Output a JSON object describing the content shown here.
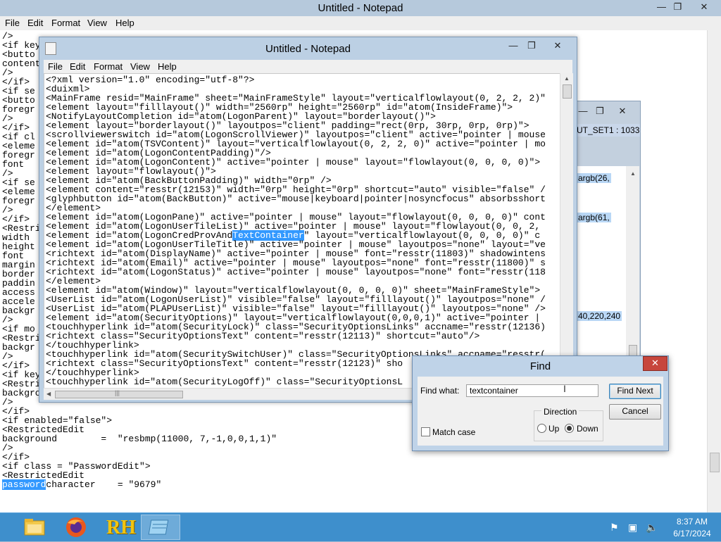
{
  "back_window": {
    "title": "Untitled - Notepad",
    "menu": [
      "File",
      "Edit",
      "Format",
      "View",
      "Help"
    ],
    "lines": [
      "/>",
      "<if key",
      "<butto",
      "content",
      "/>",
      "</if>",
      "<if se",
      "<butto",
      "foregr",
      "/>",
      "</if>",
      "<if cl",
      "<eleme",
      "foregr",
      "font",
      "/>",
      "<if se",
      "<eleme",
      "foregr",
      "/>",
      "</if>",
      "<Restri",
      "width",
      "height",
      "font",
      "margin",
      "border",
      "paddin",
      "access",
      "accele",
      "backgr",
      "/>",
      "<if mo",
      "<Restri",
      "backgr",
      "/>",
      "</if>",
      "<if key",
      "<Restri",
      "background        =  \"resbmp(11001, 7,-1,0,0,1,1)\"",
      "/>",
      "</if>",
      "<if enabled=\"false\">",
      "<RestrictedEdit",
      "background        =  \"resbmp(11000, 7,-1,0,0,1,1)\"",
      "/>",
      "</if>",
      "<if class = \"PasswordEdit\">",
      "<RestrictedEdit"
    ],
    "last_line_highlight": "password",
    "last_line_rest": "character    = \"9679\""
  },
  "mid_window": {
    "label": "UT_SET1 : 1033",
    "lines": [
      {
        "text": "argb(26,",
        "top": 0
      },
      {
        "text": "argb(61,",
        "top": 0
      },
      {
        "text": "40,220,240",
        "top": 0
      }
    ]
  },
  "front_window": {
    "title": "Untitled - Notepad",
    "menu": [
      "File",
      "Edit",
      "Format",
      "View",
      "Help"
    ],
    "lines": [
      "<?xml version=\"1.0\" encoding=\"utf-8\"?>",
      "<duixml>",
      "<MainFrame resid=\"MainFrame\" sheet=\"MainFrameStyle\" layout=\"verticalflowlayout(0, 2, 2, 2)\"",
      "<element layout=\"filllayout()\" width=\"2560rp\" height=\"2560rp\" id=\"atom(InsideFrame)\">",
      "<NotifyLayoutCompletion id=\"atom(LogonParent)\" layout=\"borderlayout()\">",
      "<element layout=\"borderlayout()\" layoutpos=\"client\" padding=\"rect(0rp, 30rp, 0rp, 0rp)\">",
      "<scrollviewerswitch id=\"atom(LogonScrollViewer)\" layoutpos=\"client\" active=\"pointer | mouse",
      "<element id=\"atom(TSVContent)\" layout=\"verticalflowlayout(0, 2, 2, 0)\" active=\"pointer | mo",
      "<element id=\"atom(LogonContentPadding)\"/>",
      "<element id=\"atom(LogonContent)\" active=\"pointer | mouse\" layout=\"flowlayout(0, 0, 0, 0)\">",
      "<element layout=\"flowlayout()\">",
      "<element id=\"atom(BackButtonPadding)\" width=\"0rp\" />",
      "<element content=\"resstr(12153)\" width=\"0rp\" height=\"0rp\" shortcut=\"auto\" visible=\"false\" /",
      "<glyphbutton id=\"atom(BackButton)\" active=\"mouse|keyboard|pointer|nosyncfocus\" absorbsshort",
      "</element>",
      "<element id=\"atom(LogonPane)\" active=\"pointer | mouse\" layout=\"flowlayout(0, 0, 0, 0)\" cont",
      "<element id=\"atom(LogonUserTileList)\" active=\"pointer | mouse\" layout=\"flowlayout(0, 0, 2,",
      "<element id=\"atom(LogonCredProvAnd",
      "<element id=\"atom(LogonUserTileTitle)\" active=\"pointer | mouse\" layoutpos=\"none\" layout=\"ve",
      "<richtext id=\"atom(DisplayName)\" active=\"pointer | mouse\" font=\"resstr(11803)\" shadowintens",
      "<richtext id=\"atom(Email)\" active=\"pointer | mouse\" layoutpos=\"none\" font=\"resstr(11800)\" s",
      "<richtext id=\"atom(LogonStatus)\" active=\"pointer | mouse\" layoutpos=\"none\" font=\"resstr(118",
      "</element>",
      "<element id=\"atom(Window)\" layout=\"verticalflowlayout(0, 0, 0, 0)\" sheet=\"MainFrameStyle\">",
      "<UserList id=\"atom(LogonUserList)\" visible=\"false\" layout=\"filllayout()\" layoutpos=\"none\" /",
      "<UserList id=\"atom(PLAPUserList)\" visible=\"false\" layout=\"filllayout()\" layoutpos=\"none\" />",
      "<element id=\"atom(SecurityOptions)\" layout=\"verticalflowlayout(0,0,0,1)\" active=\"pointer |",
      "<touchhyperlink id=\"atom(SecurityLock)\" class=\"SecurityOptionsLinks\" accname=\"resstr(12136)",
      "<richtext class=\"SecurityOptionsText\" content=\"resstr(12113)\" shortcut=\"auto\"/>",
      "</touchhyperlink>",
      "<touchhyperlink id=\"atom(SecuritySwitchUser)\" class=\"SecurityOptionsLinks\" accname=\"resstr(",
      "<richtext class=\"SecurityOptionsText\" content=\"resstr(12123)\" sho",
      "</touchhyperlink>",
      "<touchhyperlink id=\"atom(SecurityLogOff)\" class=\"SecurityOptionsL"
    ],
    "highlight_line_index": 17,
    "highlight_text": "TextContainer",
    "highlight_after": "\" layout=\"verticalflowlayout(0, 0, 0, 0)\" c"
  },
  "find_dialog": {
    "title": "Find",
    "find_what_label": "Find what:",
    "find_what_value": "textcontainer",
    "find_next_label": "Find Next",
    "cancel_label": "Cancel",
    "direction_label": "Direction",
    "up_label": "Up",
    "down_label": "Down",
    "direction_selected": "Down",
    "match_case_label": "Match case",
    "match_case_checked": false
  },
  "taskbar": {
    "items": [
      "file-explorer",
      "firefox",
      "rh-app",
      "notepad"
    ],
    "rh_label": "RH",
    "clock_time": "8:37 AM",
    "clock_date": "6/17/2024"
  },
  "colors": {
    "selection": "#3399ff",
    "taskbar": "#3e8fcc",
    "window_frame": "#bcd0e4",
    "close_button": "#c7463c"
  }
}
